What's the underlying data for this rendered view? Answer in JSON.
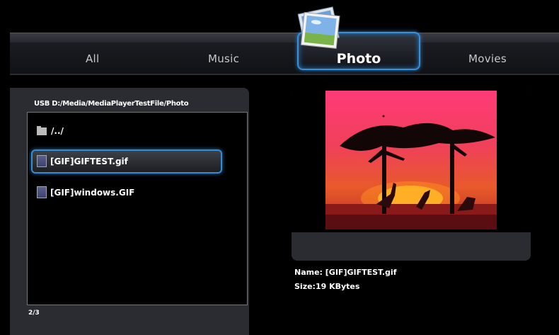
{
  "tabs": [
    {
      "label": "All"
    },
    {
      "label": "Music"
    },
    {
      "label": "Photo"
    },
    {
      "label": "Movies"
    }
  ],
  "browser": {
    "path": "USB D:/Media/MediaPlayerTestFile/Photo",
    "items": [
      {
        "label": "/../",
        "type": "folder"
      },
      {
        "label": "[GIF]GIFTEST.gif",
        "type": "file",
        "selected": true
      },
      {
        "label": "[GIF]windows.GIF",
        "type": "file"
      }
    ],
    "position": "2/3"
  },
  "preview": {
    "name_line": "Name: [GIF]GIFTEST.gif",
    "size_line": "Size:19 KBytes"
  },
  "icons": {
    "photo_tab": "photo-stack-icon",
    "folder": "folder-icon",
    "file": "image-file-icon"
  },
  "colors": {
    "accent": "#3d8fd4",
    "panel": "#2a2c31"
  }
}
